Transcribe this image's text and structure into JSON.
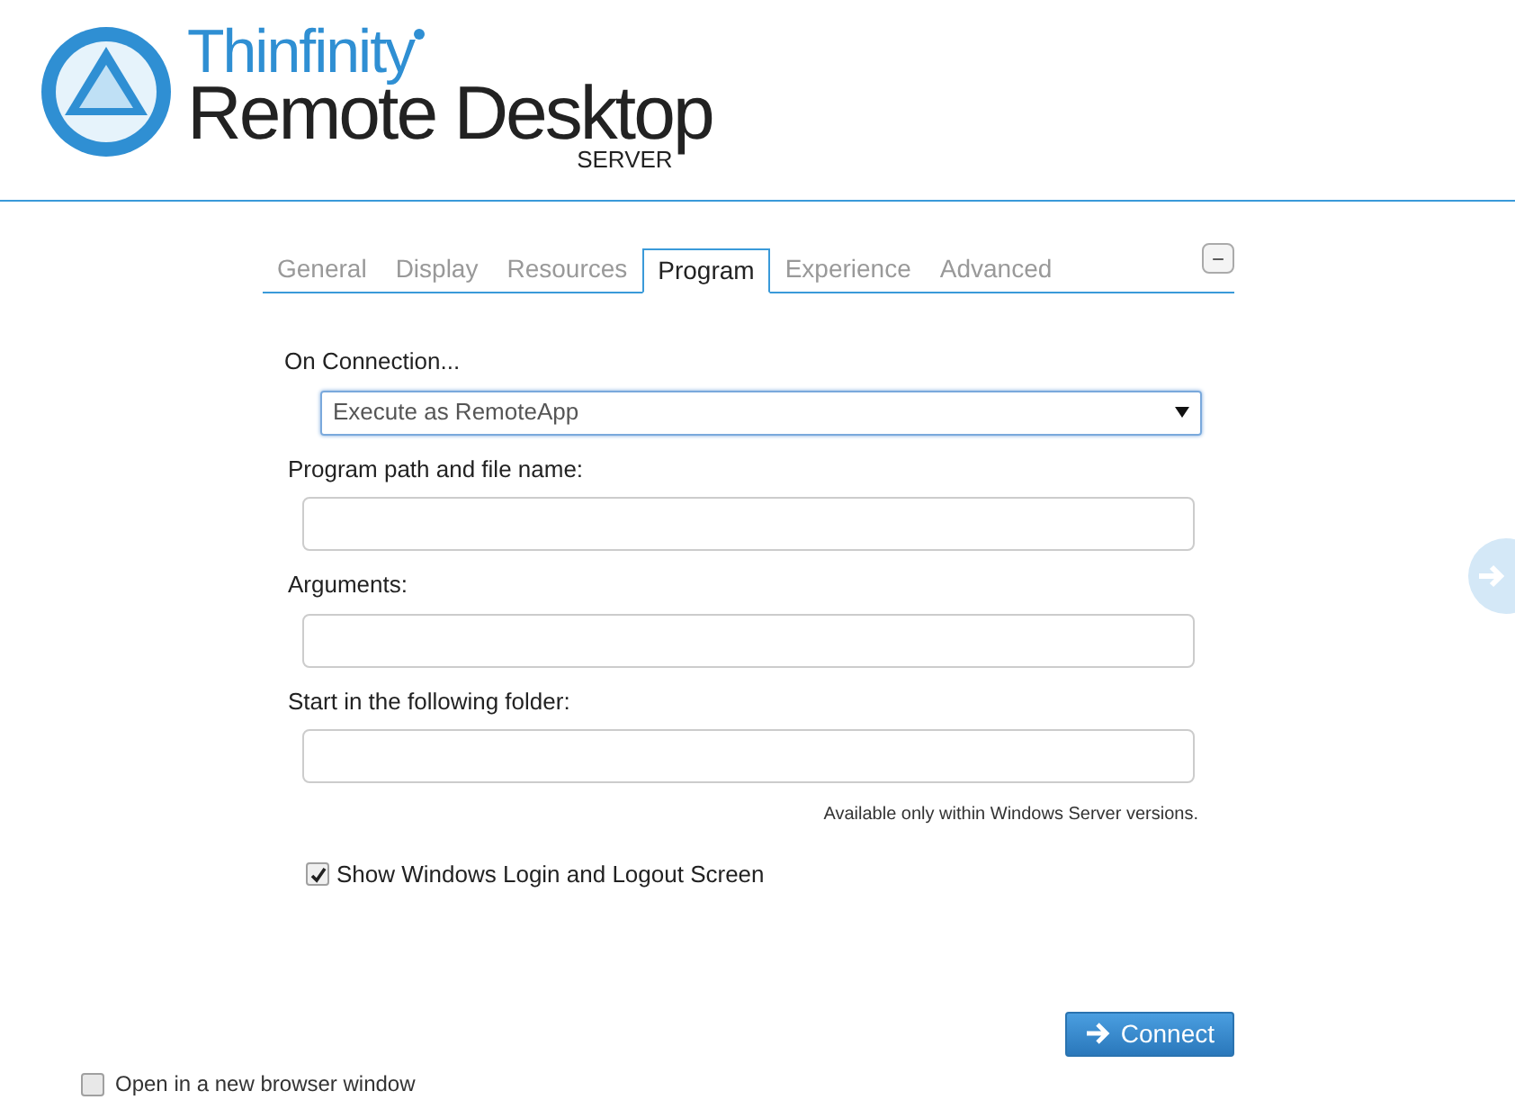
{
  "logo": {
    "brand": "Thinfinity",
    "product": "Remote Desktop",
    "edition": "SERVER"
  },
  "tabs": [
    {
      "label": "General",
      "selected": false
    },
    {
      "label": "Display",
      "selected": false
    },
    {
      "label": "Resources",
      "selected": false
    },
    {
      "label": "Program",
      "selected": true
    },
    {
      "label": "Experience",
      "selected": false
    },
    {
      "label": "Advanced",
      "selected": false
    }
  ],
  "collapse_button": "−",
  "on_connection": {
    "label": "On Connection...",
    "value": "Execute as RemoteApp"
  },
  "fields": [
    {
      "label": "Program path and file name:"
    },
    {
      "label": "Arguments:"
    },
    {
      "label": "Start in the following folder:"
    }
  ],
  "note": "Available only within Windows Server versions.",
  "show_login": {
    "label": "Show Windows Login and Logout Screen",
    "checked": true
  },
  "connect_button": "Connect",
  "new_window": {
    "label": "Open in a new browser window",
    "checked": false
  }
}
